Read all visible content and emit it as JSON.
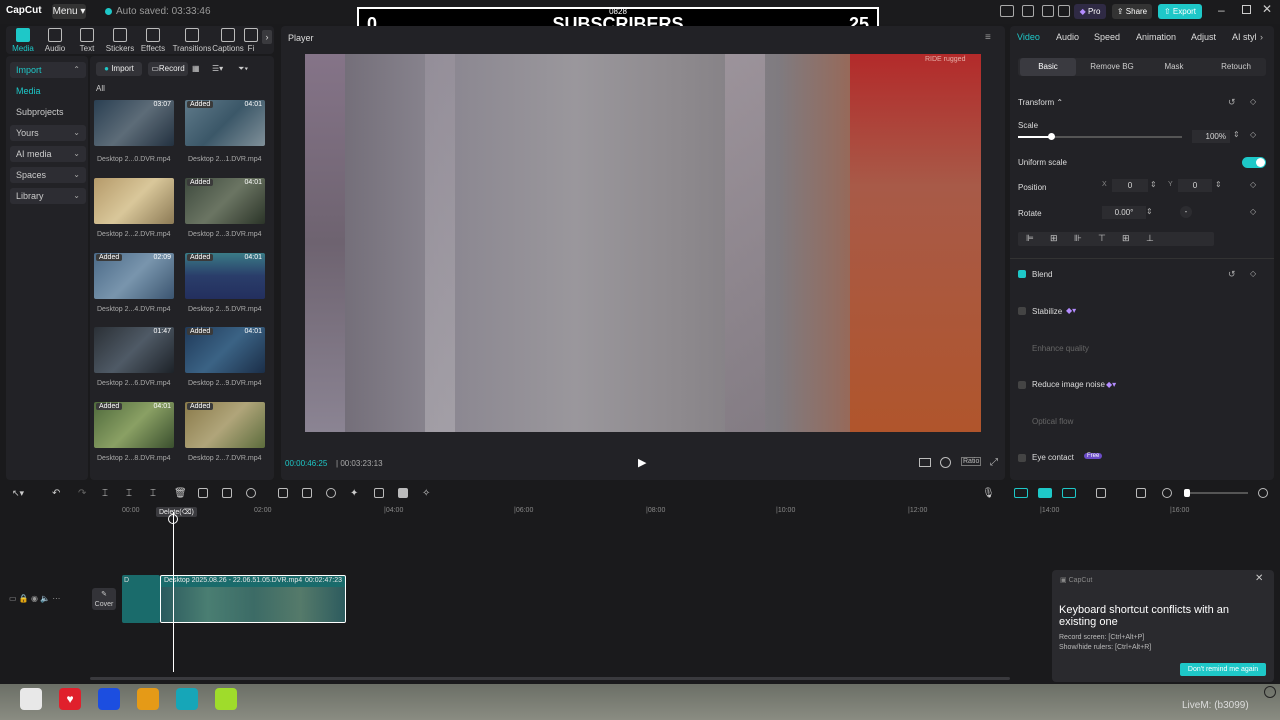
{
  "app": {
    "logo": "CapCut",
    "menu_label": "Menu",
    "autosave": "Auto saved: 03:33:46"
  },
  "window_controls": {
    "pro": "Pro",
    "share": "Share",
    "export": "Export"
  },
  "overlay": {
    "left_count": "0",
    "title": "SUBSCRIBERS",
    "right_count": "25",
    "small_text": "0828"
  },
  "left_tabs": [
    "Media",
    "Audio",
    "Text",
    "Stickers",
    "Effects",
    "Transitions",
    "Captions",
    "Fi"
  ],
  "sidebar": [
    {
      "label": "Import",
      "sel": true,
      "chev": "⌃"
    },
    {
      "label": "Media",
      "sel": false,
      "chev": ""
    },
    {
      "label": "Subprojects",
      "sel": false,
      "chev": ""
    },
    {
      "label": "Yours",
      "sel": false,
      "chev": "⌄"
    },
    {
      "label": "AI media",
      "sel": false,
      "chev": "⌄"
    },
    {
      "label": "Spaces",
      "sel": false,
      "chev": "⌄"
    },
    {
      "label": "Library",
      "sel": false,
      "chev": "⌄"
    }
  ],
  "media_header": {
    "import_btn": "Import",
    "record_btn": "Record",
    "filter_all": "All"
  },
  "media_items": [
    {
      "label": "Desktop 2...0.DVR.mp4",
      "badge": "",
      "duration": "03:07"
    },
    {
      "label": "Desktop 2...1.DVR.mp4",
      "badge": "Added",
      "duration": "04:01"
    },
    {
      "label": "Desktop 2...2.DVR.mp4",
      "badge": "",
      "duration": ""
    },
    {
      "label": "Desktop 2...3.DVR.mp4",
      "badge": "Added",
      "duration": "04:01"
    },
    {
      "label": "Desktop 2...4.DVR.mp4",
      "badge": "Added",
      "duration": "02:09"
    },
    {
      "label": "Desktop 2...5.DVR.mp4",
      "badge": "Added",
      "duration": "04:01"
    },
    {
      "label": "Desktop 2...6.DVR.mp4",
      "badge": "",
      "duration": "01:47"
    },
    {
      "label": "Desktop 2...9.DVR.mp4",
      "badge": "Added",
      "duration": "04:01"
    },
    {
      "label": "Desktop 2...8.DVR.mp4",
      "badge": "Added",
      "duration": "04:01"
    },
    {
      "label": "Desktop 2...7.DVR.mp4",
      "badge": "Added",
      "duration": ""
    }
  ],
  "player": {
    "title": "Player",
    "current_time": "00:00:46:25",
    "total_time": "00:03:23:13",
    "watermark": "RIDE rugged",
    "ratio": "Ratio"
  },
  "right_tabs": [
    "Video",
    "Audio",
    "Speed",
    "Animation",
    "Adjust",
    "AI styl"
  ],
  "right_subtabs": [
    "Basic",
    "Remove BG",
    "Mask",
    "Retouch"
  ],
  "props": {
    "transform": "Transform",
    "scale": "Scale",
    "scale_value": "100%",
    "uniform_scale": "Uniform scale",
    "position": "Position",
    "pos_x_label": "X",
    "pos_x": "0",
    "pos_y_label": "Y",
    "pos_y": "0",
    "rotate": "Rotate",
    "rotate_value": "0.00°",
    "blend": "Blend",
    "stabilize": "Stabilize",
    "enhance_quality": "Enhance quality",
    "reduce_noise": "Reduce image noise",
    "optical_flow": "Optical flow",
    "eye_contact": "Eye contact",
    "free_badge": "Free"
  },
  "timeline": {
    "ruler": [
      "00:00",
      "02:00",
      "|04:00",
      "|06:00",
      "|08:00",
      "|10:00",
      "|12:00",
      "|14:00",
      "|16:00"
    ],
    "tooltip": "Delete(⌫)",
    "cover": "Cover",
    "clip_name": "Desktop 2025.08.26 - 22.06.51.05.DVR.mp4",
    "clip_duration": "00:02:47:23",
    "clip_prefix": "D"
  },
  "toast": {
    "app": "CapCut",
    "title": "Keyboard shortcut conflicts with an existing one",
    "line1": "Record screen: [Ctrl+Alt+P]",
    "line2": "Show/hide rulers: [Ctrl+Alt+R]",
    "button": "Don't remind me again"
  },
  "bottom_watermark": "LiveM: (b3099)",
  "taskbar_colors": [
    "#e8e8e8",
    "#e0202c",
    "#1c4ee0",
    "#e59a17",
    "#16a6b8",
    "#9fdc2b"
  ],
  "accent": "#1ec8c8"
}
